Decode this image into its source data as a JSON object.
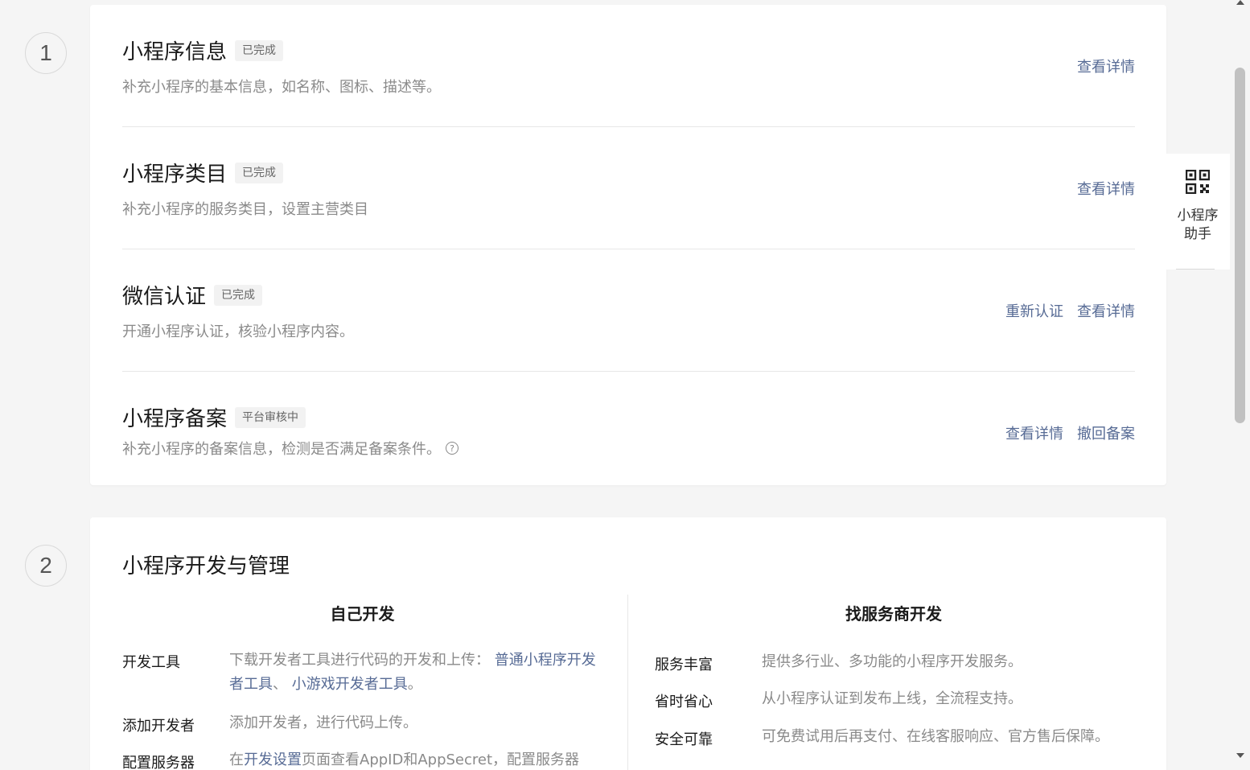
{
  "step1": {
    "number": "1",
    "rows": [
      {
        "title": "小程序信息",
        "badge": "已完成",
        "desc": "补充小程序的基本信息，如名称、图标、描述等。",
        "actions": [
          "查看详情"
        ]
      },
      {
        "title": "小程序类目",
        "badge": "已完成",
        "desc": "补充小程序的服务类目，设置主营类目",
        "actions": [
          "查看详情"
        ]
      },
      {
        "title": "微信认证",
        "badge": "已完成",
        "desc": "开通小程序认证，核验小程序内容。",
        "actions": [
          "重新认证",
          "查看详情"
        ]
      },
      {
        "title": "小程序备案",
        "badge": "平台审核中",
        "desc": "补充小程序的备案信息，检测是否满足备案条件。",
        "actions": [
          "查看详情",
          "撤回备案"
        ]
      }
    ]
  },
  "step2": {
    "number": "2",
    "title": "小程序开发与管理",
    "self_dev": {
      "heading": "自己开发",
      "items": [
        {
          "label": "开发工具",
          "text": "下载开发者工具进行代码的开发和上传：",
          "link1": "普通小程序开发者工具",
          "sep": "、",
          "link2": "小游戏开发者工具",
          "end": "。"
        },
        {
          "label": "添加开发者",
          "text": "添加开发者，进行代码上传。"
        },
        {
          "label": "配置服务器",
          "text_a": "在",
          "link": "开发设置",
          "text_b": "页面查看AppID和AppSecret，配置服务器"
        }
      ]
    },
    "vendor_dev": {
      "heading": "找服务商开发",
      "items": [
        {
          "label": "服务丰富",
          "text": "提供多行业、多功能的小程序开发服务。"
        },
        {
          "label": "省时省心",
          "text": "从小程序认证到发布上线，全流程支持。"
        },
        {
          "label": "安全可靠",
          "text": "可免费试用后再支付、在线客服响应、官方售后保障。"
        }
      ]
    }
  },
  "helper": {
    "label_line1": "小程序",
    "label_line2": "助手",
    "icon": "qrcode-icon"
  },
  "colors": {
    "link": "#576b95",
    "muted": "#8a8a8a",
    "badge_bg": "#f2f2f2"
  }
}
